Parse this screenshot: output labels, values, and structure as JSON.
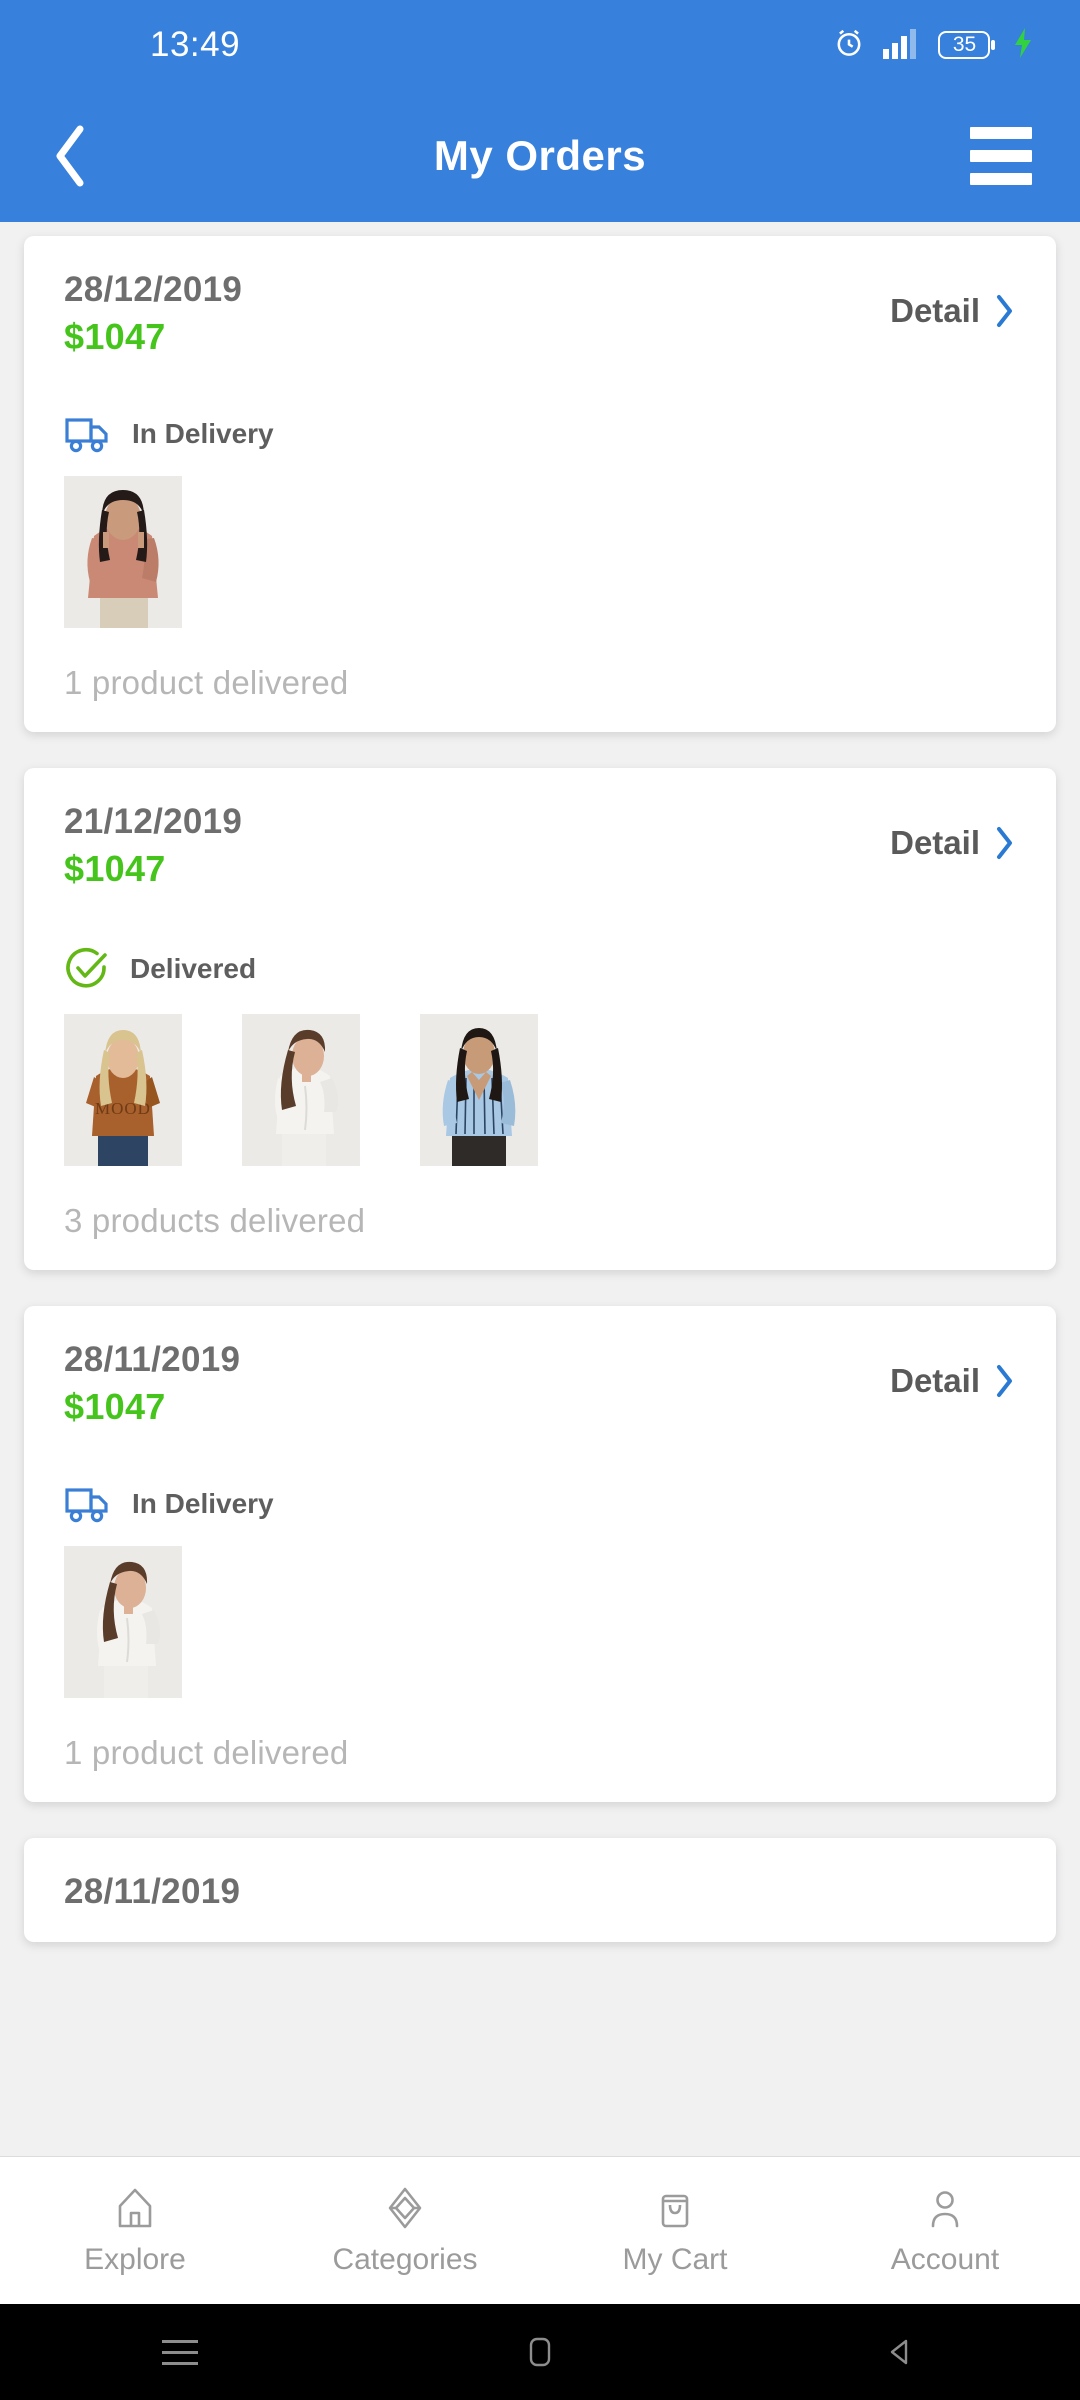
{
  "status_bar": {
    "time": "13:49",
    "battery_percent": "35",
    "icons": [
      "alarm-clock-icon",
      "signal-bars-icon",
      "battery-icon",
      "charging-bolt-icon"
    ]
  },
  "app_bar": {
    "title": "My Orders",
    "back_icon": "chevron-left-icon",
    "menu_icon": "hamburger-menu-icon"
  },
  "colors": {
    "header_blue": "#3780dc",
    "price_green": "#45c51c",
    "delivered_green": "#64b816",
    "truck_blue": "#3a7fd5",
    "chevron_blue": "#2a7ad4",
    "muted_gray": "#b6b6b6"
  },
  "orders": [
    {
      "date": "28/12/2019",
      "price": "$1047",
      "detail_label": "Detail",
      "status_label": "In Delivery",
      "status_icon": "delivery-truck-icon",
      "summary": "1 product delivered",
      "products": [
        {
          "name": "rose-ruffle-blouse",
          "top": "#c98975",
          "bottom": "#d8cdb8",
          "hair": "#241b18",
          "skin": "#c99a7c"
        }
      ]
    },
    {
      "date": "21/12/2019",
      "price": "$1047",
      "detail_label": "Detail",
      "status_label": "Delivered",
      "status_icon": "check-circle-icon",
      "summary": "3 products delivered",
      "products": [
        {
          "name": "brown-mood-tee",
          "top": "#a8602c",
          "bottom": "#2d4463",
          "hair": "#d9c38f",
          "skin": "#e3bb98"
        },
        {
          "name": "white-drawstring-set",
          "top": "#f4f3f0",
          "bottom": "#efeeea",
          "hair": "#5a3c2a",
          "skin": "#dcb195"
        },
        {
          "name": "blue-striped-shirt",
          "top": "#a9c8e4",
          "bottom": "#2e2b28",
          "hair": "#1e1713",
          "skin": "#c79a78"
        }
      ]
    },
    {
      "date": "28/11/2019",
      "price": "$1047",
      "detail_label": "Detail",
      "status_label": "In Delivery",
      "status_icon": "delivery-truck-icon",
      "summary": "1 product delivered",
      "products": [
        {
          "name": "white-drawstring-set",
          "top": "#f4f3f0",
          "bottom": "#efeeea",
          "hair": "#5a3c2a",
          "skin": "#dcb195"
        }
      ]
    },
    {
      "date": "28/11/2019",
      "price": "",
      "detail_label": "",
      "status_label": "",
      "status_icon": "",
      "summary": "",
      "products": []
    }
  ],
  "bottom_nav": {
    "items": [
      {
        "label": "Explore",
        "icon": "home-icon"
      },
      {
        "label": "Categories",
        "icon": "cube-diamond-icon"
      },
      {
        "label": "My Cart",
        "icon": "shopping-bag-icon"
      },
      {
        "label": "Account",
        "icon": "person-icon"
      }
    ]
  },
  "android_nav": {
    "items": [
      {
        "icon": "recent-apps-icon"
      },
      {
        "icon": "home-square-icon"
      },
      {
        "icon": "back-triangle-icon"
      }
    ]
  }
}
